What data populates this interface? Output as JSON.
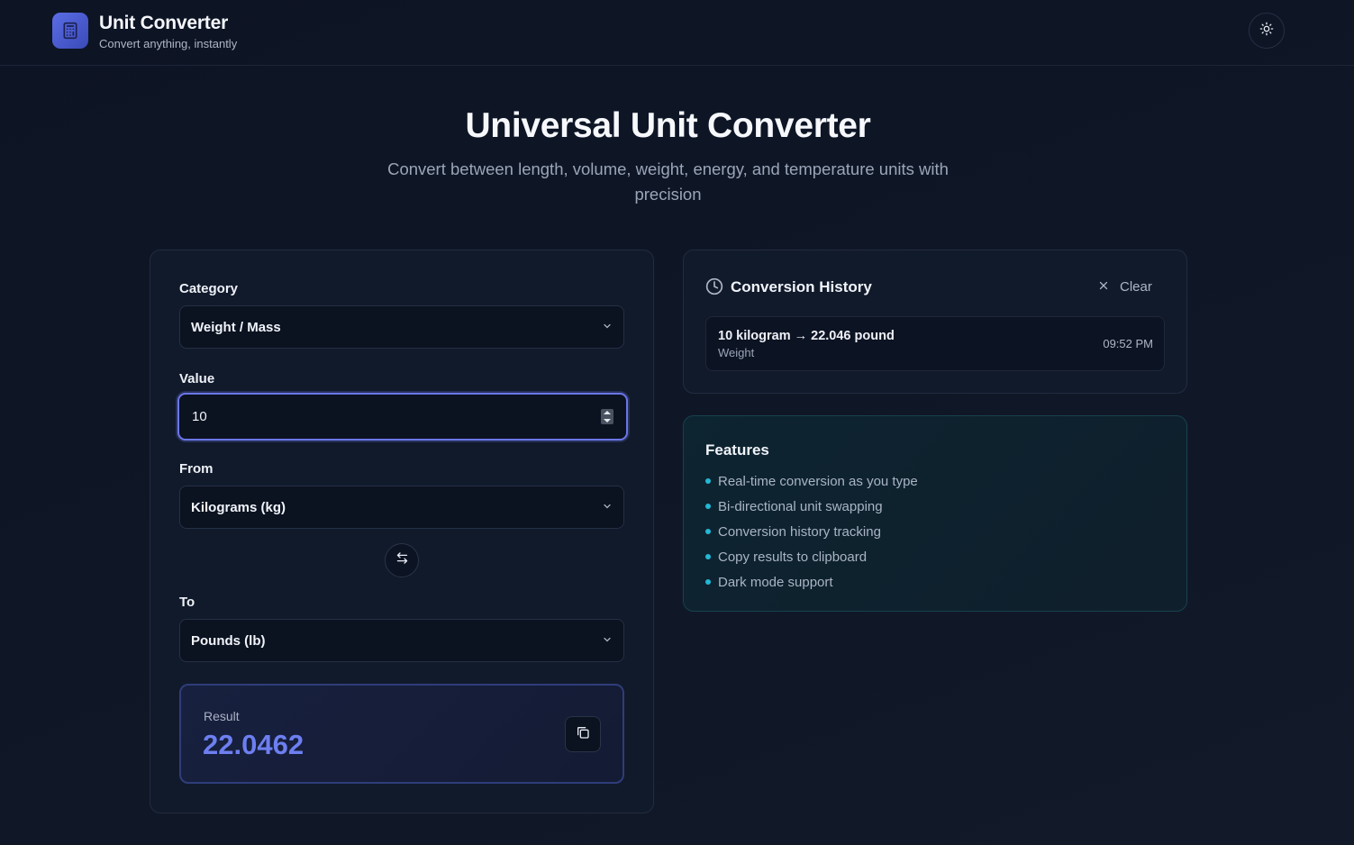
{
  "header": {
    "title": "Unit Converter",
    "subtitle": "Convert anything, instantly",
    "logo_icon": "calculator-icon",
    "theme_icon": "sun-icon"
  },
  "hero": {
    "title": "Universal Unit Converter",
    "subtitle": "Convert between length, volume, weight, energy, and temperature units with precision"
  },
  "converter": {
    "category_label": "Category",
    "category_value": "Weight / Mass",
    "value_label": "Value",
    "value": "10",
    "from_label": "From",
    "from_value": "Kilograms (kg)",
    "to_label": "To",
    "to_value": "Pounds (lb)",
    "result_label": "Result",
    "result_value": "22.0462",
    "swap_icon": "swap-arrows-icon",
    "copy_icon": "copy-icon"
  },
  "history": {
    "title": "Conversion History",
    "clear_label": "Clear",
    "items": [
      {
        "text": "10 kilogram → 22.046 pound",
        "category": "Weight",
        "time": "09:52 PM"
      }
    ]
  },
  "features": {
    "title": "Features",
    "items": [
      "Real-time conversion as you type",
      "Bi-directional unit swapping",
      "Conversion history tracking",
      "Copy results to clipboard",
      "Dark mode support"
    ]
  },
  "colors": {
    "accent": "#6d7ff0",
    "feature_dot": "#22b8d6",
    "background": "#0f1727"
  }
}
